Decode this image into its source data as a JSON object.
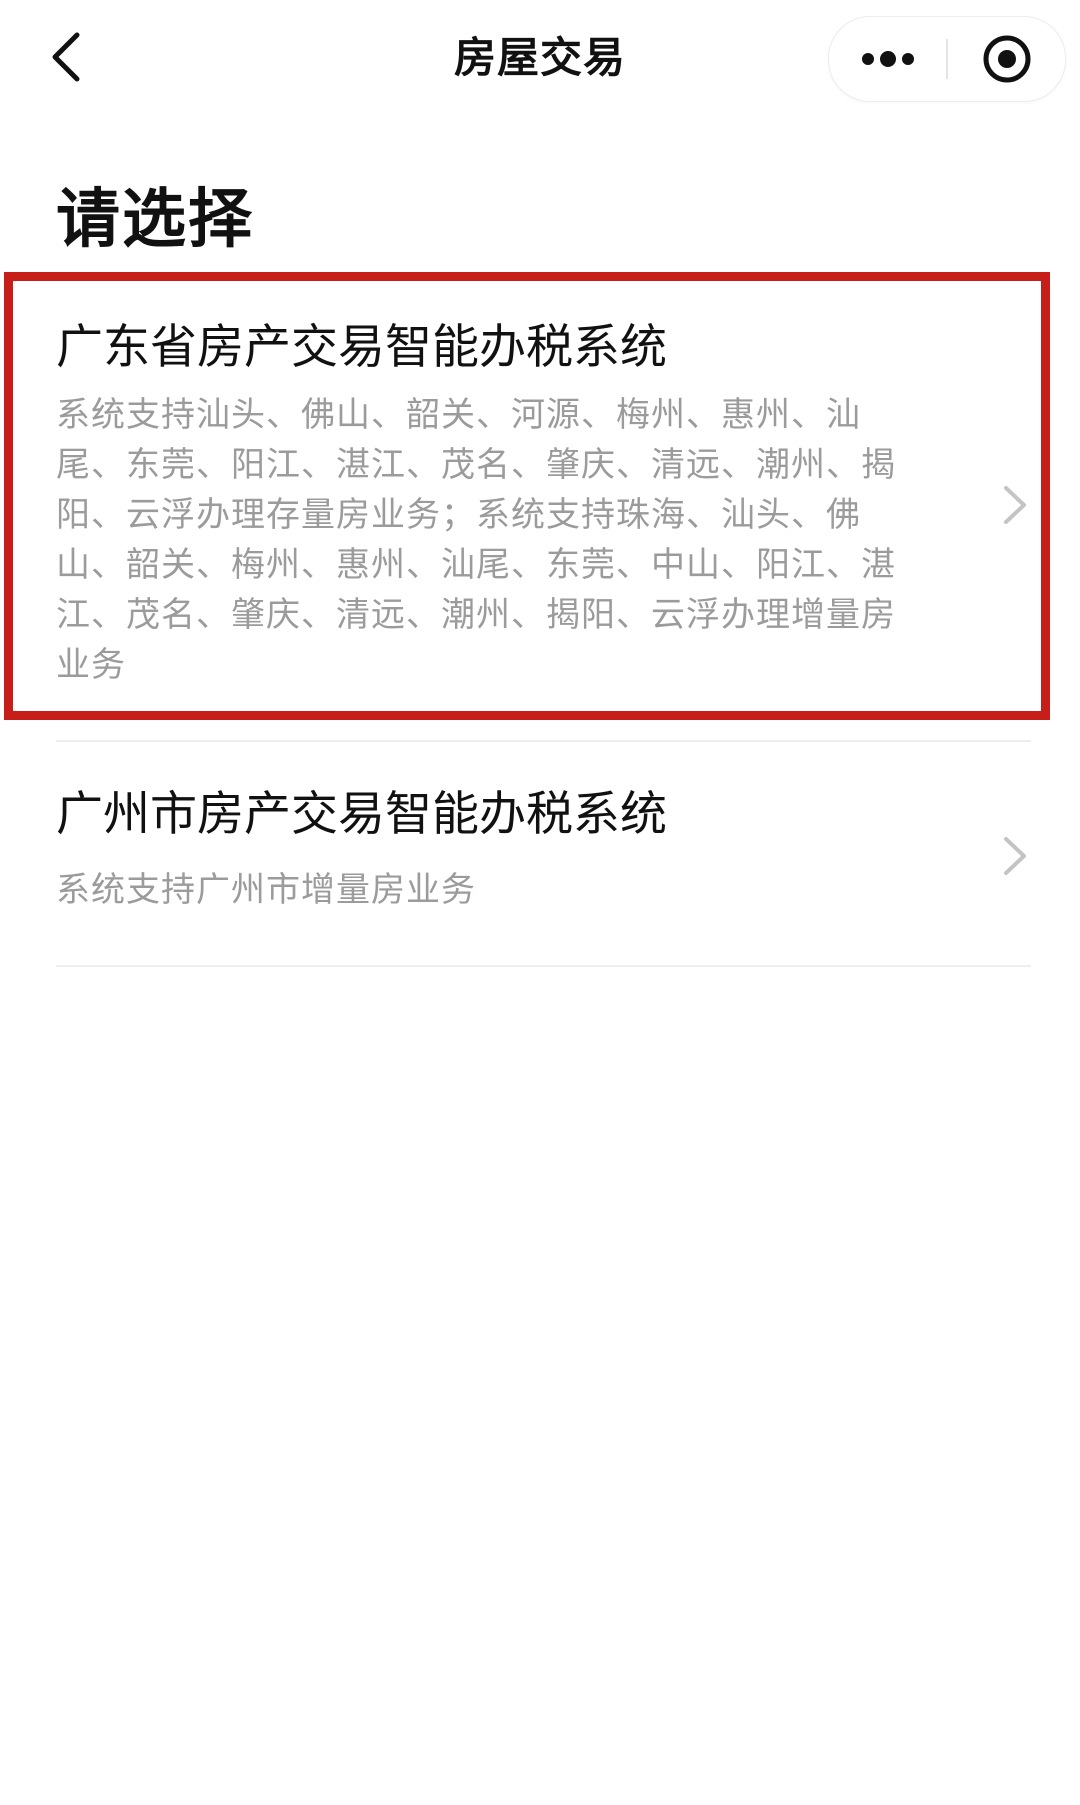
{
  "header": {
    "title": "房屋交易",
    "back_icon": "chevron-left-icon",
    "more_icon": "more-dots-icon",
    "close_icon": "target-close-icon"
  },
  "page": {
    "heading": "请选择"
  },
  "list": {
    "items": [
      {
        "title": "广东省房产交易智能办税系统",
        "description": "系统支持汕头、佛山、韶关、河源、梅州、惠州、汕尾、东莞、阳江、湛江、茂名、肇庆、清远、潮州、揭阳、云浮办理存量房业务；系统支持珠海、汕头、佛山、韶关、梅州、惠州、汕尾、东莞、中山、阳江、湛江、茂名、肇庆、清远、潮州、揭阳、云浮办理增量房业务",
        "highlighted": true
      },
      {
        "title": "广州市房产交易智能办税系统",
        "description": "系统支持广州市增量房业务",
        "highlighted": false
      }
    ]
  },
  "colors": {
    "highlight_border": "#c81e1a",
    "description_text": "#9b9b9b",
    "title_text": "#111111",
    "divider": "#eeeeee"
  }
}
